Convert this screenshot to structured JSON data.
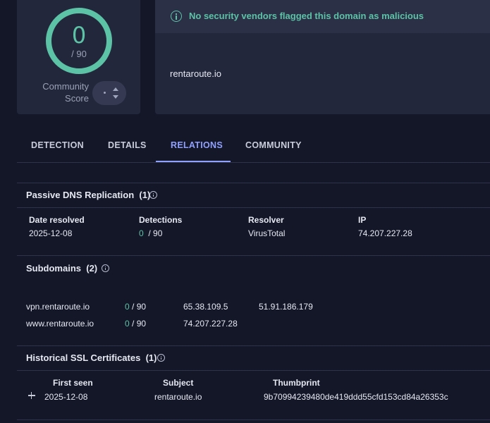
{
  "score": {
    "value": "0",
    "total": "/ 90",
    "community_label_line1": "Community",
    "community_label_line2": "Score",
    "ring_color": "#5cc3a6"
  },
  "banner": {
    "icon": "info-circle-icon",
    "message": "No security vendors flagged this domain as malicious"
  },
  "domain": "rentaroute.io",
  "tabs": [
    {
      "label": "DETECTION",
      "active": false
    },
    {
      "label": "DETAILS",
      "active": false
    },
    {
      "label": "RELATIONS",
      "active": true
    },
    {
      "label": "COMMUNITY",
      "active": false
    }
  ],
  "passive_dns": {
    "title": "Passive DNS Replication",
    "count": "(1)",
    "columns": [
      "Date resolved",
      "Detections",
      "Resolver",
      "IP"
    ],
    "rows": [
      {
        "date": "2025-12-08",
        "detections": "0",
        "detections_total": "/ 90",
        "resolver": "VirusTotal",
        "ip": "74.207.227.28"
      }
    ]
  },
  "subdomains": {
    "title": "Subdomains",
    "count": "(2)",
    "rows": [
      {
        "name": "vpn.rentaroute.io",
        "detections": "0",
        "detections_total": "/ 90",
        "ip1": "65.38.109.5",
        "ip2": "51.91.186.179"
      },
      {
        "name": "www.rentaroute.io",
        "detections": "0",
        "detections_total": "/ 90",
        "ip1": "74.207.227.28",
        "ip2": ""
      }
    ]
  },
  "ssl": {
    "title": "Historical SSL Certificates",
    "count": "(1)",
    "columns": [
      "First seen",
      "Subject",
      "Thumbprint"
    ],
    "rows": [
      {
        "first_seen": "2025-12-08",
        "subject": "rentaroute.io",
        "thumbprint": "9b70994239480de419ddd55cfd153cd84a26353c"
      }
    ]
  },
  "colors": {
    "background": "#141728",
    "card": "#23273b",
    "accent_green": "#5cc3a6",
    "accent_tab": "#8fa0ff"
  }
}
